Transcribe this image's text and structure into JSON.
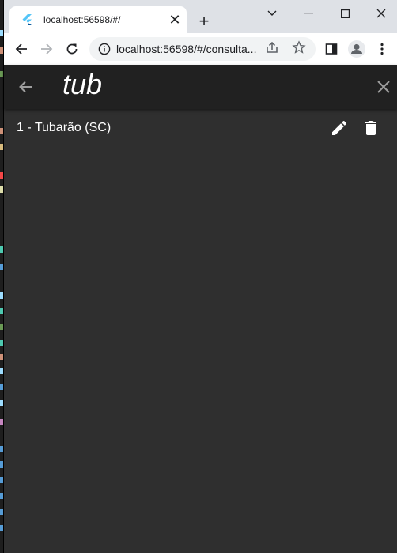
{
  "browser": {
    "tab": {
      "title": "localhost:56598/#/",
      "close": "✕"
    },
    "new_tab": "+",
    "address_bar": {
      "url": "localhost:56598/#/consulta..."
    }
  },
  "app": {
    "search_value": "tub",
    "results": [
      {
        "label": "1 - Tubarão (SC)"
      }
    ]
  },
  "colors": {
    "app_bg": "#2f2f2f",
    "appbar_bg": "#212121",
    "text": "#ffffff"
  }
}
